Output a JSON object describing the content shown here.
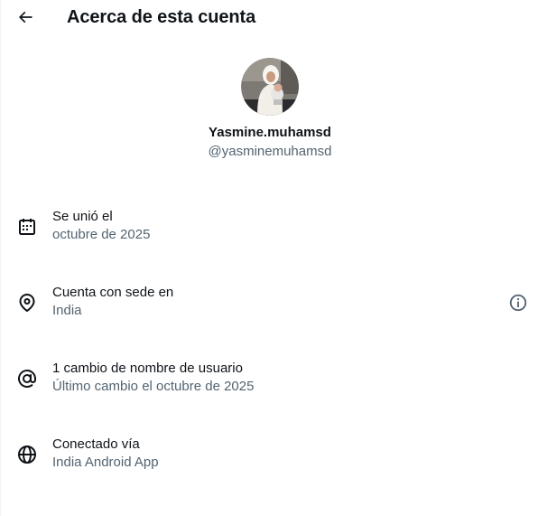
{
  "header": {
    "title": "Acerca de esta cuenta",
    "back_icon": "arrow-left-icon"
  },
  "profile": {
    "display_name": "Yasmine.muhamsd",
    "handle": "@yasminemuhamsd",
    "avatar_icon": "profile-photo"
  },
  "details": [
    {
      "icon": "calendar-icon",
      "title": "Se unió el",
      "subtitle": "octubre de 2025"
    },
    {
      "icon": "location-pin-icon",
      "title": "Cuenta con sede en",
      "subtitle": "India",
      "info_icon": "info-icon"
    },
    {
      "icon": "at-sign-icon",
      "title": "1 cambio de nombre de usuario",
      "subtitle": "Último cambio el octubre de 2025"
    },
    {
      "icon": "globe-icon",
      "title": "Conectado vía",
      "subtitle": "India Android App"
    }
  ],
  "colors": {
    "text_primary": "#0f1419",
    "text_secondary": "#536471",
    "background": "#ffffff"
  }
}
